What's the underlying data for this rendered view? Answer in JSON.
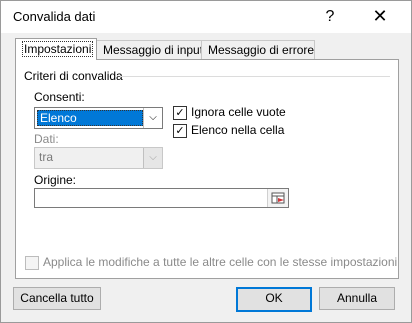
{
  "window": {
    "title": "Convalida dati",
    "help_glyph": "?",
    "close_glyph": "✕"
  },
  "tabs": [
    {
      "label": "Impostazioni",
      "active": true
    },
    {
      "label": "Messaggio di input",
      "active": false
    },
    {
      "label": "Messaggio di errore",
      "active": false
    }
  ],
  "criteria": {
    "group_title": "Criteri di convalida",
    "allow_label": "Consenti:",
    "allow_value": "Elenco",
    "data_label": "Dati:",
    "data_value": "tra",
    "ignore_blank": {
      "label": "Ignora celle vuote",
      "checked": true
    },
    "in_cell_dropdown": {
      "label": "Elenco nella cella",
      "checked": true
    },
    "source_label": "Origine:",
    "source_value": ""
  },
  "apply_all": {
    "label": "Applica le modifiche a tutte le altre celle con le stesse impostazioni",
    "checked": false,
    "enabled": false
  },
  "buttons": {
    "clear_all": "Cancella tutto",
    "ok": "OK",
    "cancel": "Annulla"
  },
  "glyphs": {
    "checkmark": "✓",
    "dropdown_arrow": "⌵"
  },
  "colors": {
    "accent": "#0078d7",
    "selection_bg": "#0078d7"
  }
}
